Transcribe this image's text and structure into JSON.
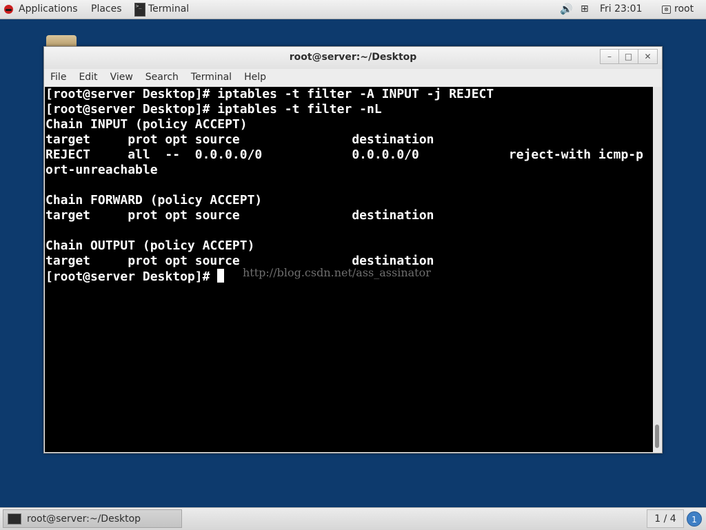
{
  "top_panel": {
    "applications": "Applications",
    "places": "Places",
    "task": "Terminal",
    "volume_icon": "🔊",
    "network_icon": "⊞",
    "clock": "Fri 23:01",
    "user_glyph": "⊗",
    "user": "root"
  },
  "window": {
    "title": "root@server:~/Desktop",
    "minimize": "–",
    "maximize": "□",
    "close": "✕",
    "menu": {
      "file": "File",
      "edit": "Edit",
      "view": "View",
      "search": "Search",
      "terminal": "Terminal",
      "help": "Help"
    }
  },
  "terminal": {
    "lines": [
      "[root@server Desktop]# iptables -t filter -A INPUT -j REJECT",
      "[root@server Desktop]# iptables -t filter -nL",
      "Chain INPUT (policy ACCEPT)",
      "target     prot opt source               destination",
      "REJECT     all  --  0.0.0.0/0            0.0.0.0/0            reject-with icmp-p",
      "ort-unreachable",
      "",
      "Chain FORWARD (policy ACCEPT)",
      "target     prot opt source               destination",
      "",
      "Chain OUTPUT (policy ACCEPT)",
      "target     prot opt source               destination"
    ],
    "prompt": "[root@server Desktop]# ",
    "watermark": "http://blog.csdn.net/ass_assinator"
  },
  "bottom_panel": {
    "task": "root@server:~/Desktop",
    "workspace": "1 / 4",
    "notifications": "1"
  }
}
